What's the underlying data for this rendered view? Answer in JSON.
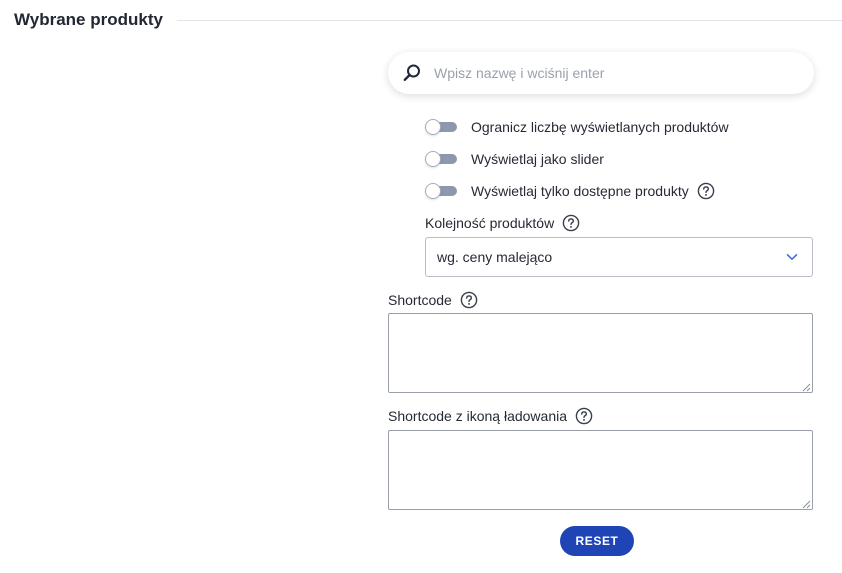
{
  "section": {
    "title": "Wybrane produkty"
  },
  "search": {
    "placeholder": "Wpisz nazwę i wciśnij enter",
    "value": ""
  },
  "options": {
    "limit_count": {
      "label": "Ogranicz liczbę wyświetlanych produktów",
      "on": false
    },
    "as_slider": {
      "label": "Wyświetlaj jako slider",
      "on": false
    },
    "only_available": {
      "label": "Wyświetlaj tylko dostępne produkty",
      "on": false
    }
  },
  "order": {
    "label": "Kolejność produktów",
    "selected": "wg. ceny malejąco"
  },
  "shortcode": {
    "label": "Shortcode",
    "value": ""
  },
  "shortcode_loading": {
    "label": "Shortcode z ikoną ładowania",
    "value": ""
  },
  "reset": {
    "label": "RESET"
  },
  "colors": {
    "accent": "#1e44b6",
    "toggle_track": "#8d98ad",
    "select_chevron": "#3f6ad8"
  },
  "icons": {
    "search": "search-icon",
    "help": "question-circle-icon",
    "select": "chevron-down-icon"
  }
}
